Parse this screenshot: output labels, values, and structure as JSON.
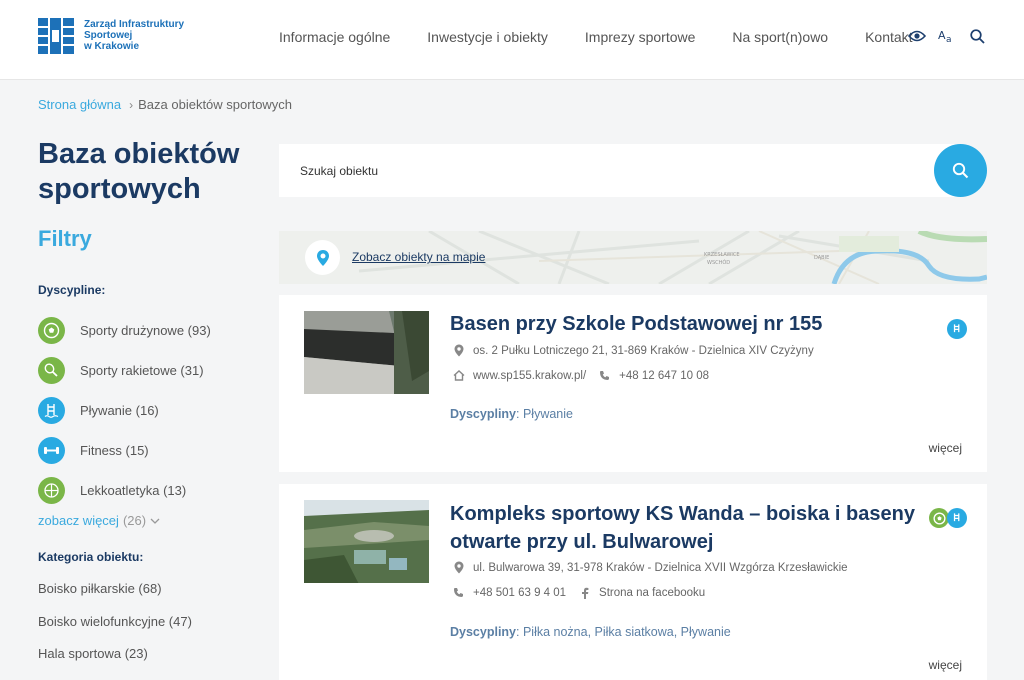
{
  "header": {
    "logo_lines": [
      "Zarząd Infrastruktury",
      "Sportowej",
      "w Krakowie"
    ],
    "nav": [
      "Informacje ogólne",
      "Inwestycje i obiekty",
      "Imprezy sportowe",
      "Na sport(n)owo",
      "Kontakt"
    ],
    "tools": [
      "eye-icon",
      "font-size-icon",
      "search-icon"
    ],
    "brand_color": "#1d71b8"
  },
  "breadcrumb": {
    "home": "Strona główna",
    "current": "Baza obiektów sportowych"
  },
  "sidebar": {
    "title": "Baza obiektów sportowych",
    "filters_title": "Filtry",
    "disciplines_title": "Dyscypline:",
    "disciplines": [
      {
        "label": "Sporty drużynowe (93)",
        "icon": "ball-icon",
        "color": "#7ab648"
      },
      {
        "label": "Sporty rakietowe (31)",
        "icon": "racket-icon",
        "color": "#7ab648"
      },
      {
        "label": "Pływanie (16)",
        "icon": "pool-icon",
        "color": "#29aae2"
      },
      {
        "label": "Fitness (15)",
        "icon": "dumbbell-icon",
        "color": "#29aae2"
      },
      {
        "label": "Lekkoatletyka (13)",
        "icon": "runner-icon",
        "color": "#7ab648"
      }
    ],
    "more_label": "zobacz więcej",
    "more_count": "(26)",
    "category_title": "Kategoria obiektu:",
    "categories": [
      "Boisko piłkarskie (68)",
      "Boisko wielofunkcyjne (47)",
      "Hala sportowa (23)"
    ]
  },
  "search": {
    "placeholder": "Szukaj obiektu"
  },
  "map": {
    "link": "Zobacz obiekty na mapie",
    "labels": [
      "KRZESŁAWICE",
      "WSCHÓD",
      "DĄBIE"
    ]
  },
  "results": [
    {
      "title": "Basen przy Szkole Podstawowej nr 155",
      "address": "os. 2 Pułku Lotniczego 21, 31-869 Kraków - Dzielnica XIV Czyżyny",
      "website": "www.sp155.krakow.pl/",
      "phone": "+48 12 647 10 08",
      "disciplines_label": "Dyscypliny",
      "disciplines": ": Pływanie",
      "more": "więcej"
    },
    {
      "title": "Kompleks sportowy KS Wanda – boiska i baseny otwarte przy ul. Bulwarowej",
      "address": "ul. Bulwarowa 39, 31-978 Kraków - Dzielnica XVII Wzgórza Krzesławickie",
      "phone": "+48 501 63 9 4 01",
      "facebook": "Strona na facebooku",
      "disciplines_label": "Dyscypliny",
      "disciplines": ": Piłka nożna, Piłka siatkowa, Pływanie",
      "more": "więcej"
    }
  ],
  "colors": {
    "accent": "#29aae2",
    "navy": "#1b3a63",
    "green": "#7ab648"
  }
}
